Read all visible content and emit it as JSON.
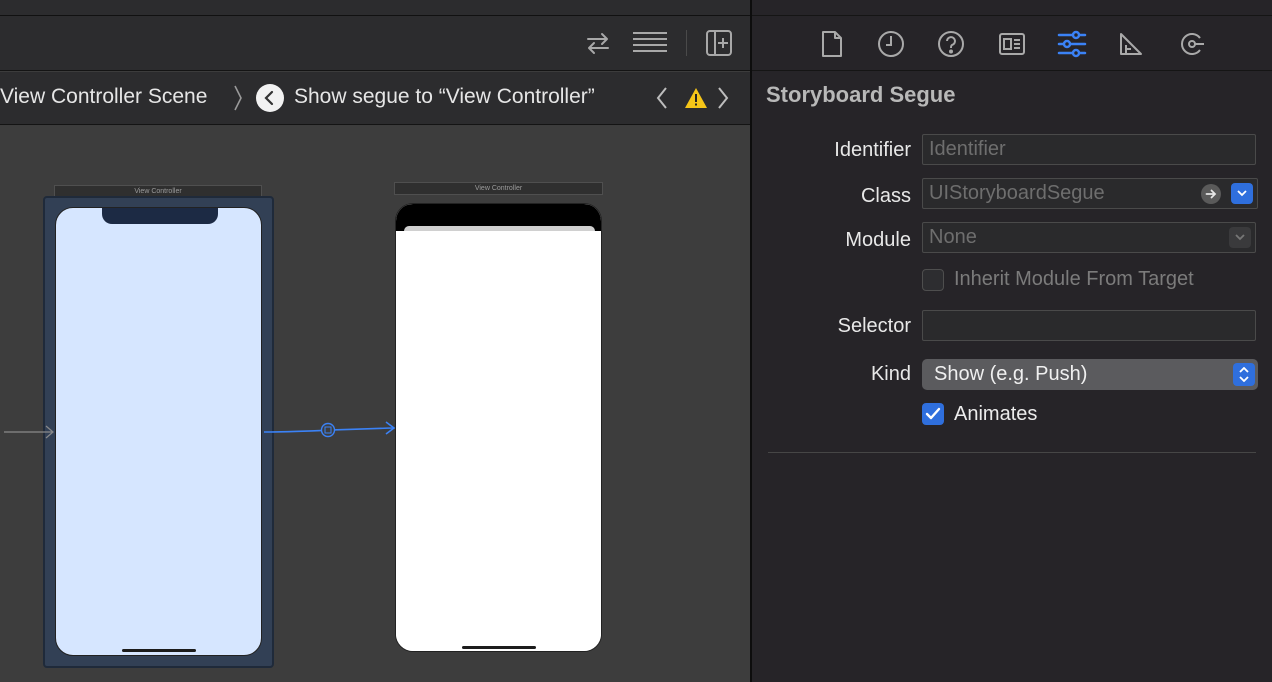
{
  "jump_bar": {
    "crumb_scene": "View Controller Scene",
    "crumb_segue": "Show segue to “View Controller”"
  },
  "canvas": {
    "source_vc_title": "View Controller",
    "dest_vc_title": "View Controller"
  },
  "toolbar": {
    "icons": [
      "swap-arrows-icon",
      "text-lines-icon",
      "add-editor-icon"
    ]
  },
  "inspector": {
    "tabs": [
      "file-icon",
      "history-icon",
      "help-icon",
      "identity-icon",
      "attributes-icon",
      "size-icon",
      "connections-icon"
    ],
    "active_tab": "attributes-icon",
    "heading": "Storyboard Segue",
    "identifier": {
      "label": "Identifier",
      "placeholder": "Identifier",
      "value": ""
    },
    "class": {
      "label": "Class",
      "placeholder": "UIStoryboardSegue",
      "value": ""
    },
    "module": {
      "label": "Module",
      "placeholder": "None",
      "value": ""
    },
    "inherit_module": {
      "label": "Inherit Module From Target",
      "checked": false
    },
    "selector": {
      "label": "Selector",
      "value": ""
    },
    "kind": {
      "label": "Kind",
      "value": "Show (e.g. Push)"
    },
    "animates": {
      "label": "Animates",
      "checked": true
    }
  },
  "colors": {
    "accent": "#2f6fdd",
    "active_tab": "#3b82f6",
    "segue_line": "#3b82f6",
    "vc_selected_fill": "#324055",
    "vc_source_bg": "#d6e6ff",
    "warning": "#f5c518"
  }
}
